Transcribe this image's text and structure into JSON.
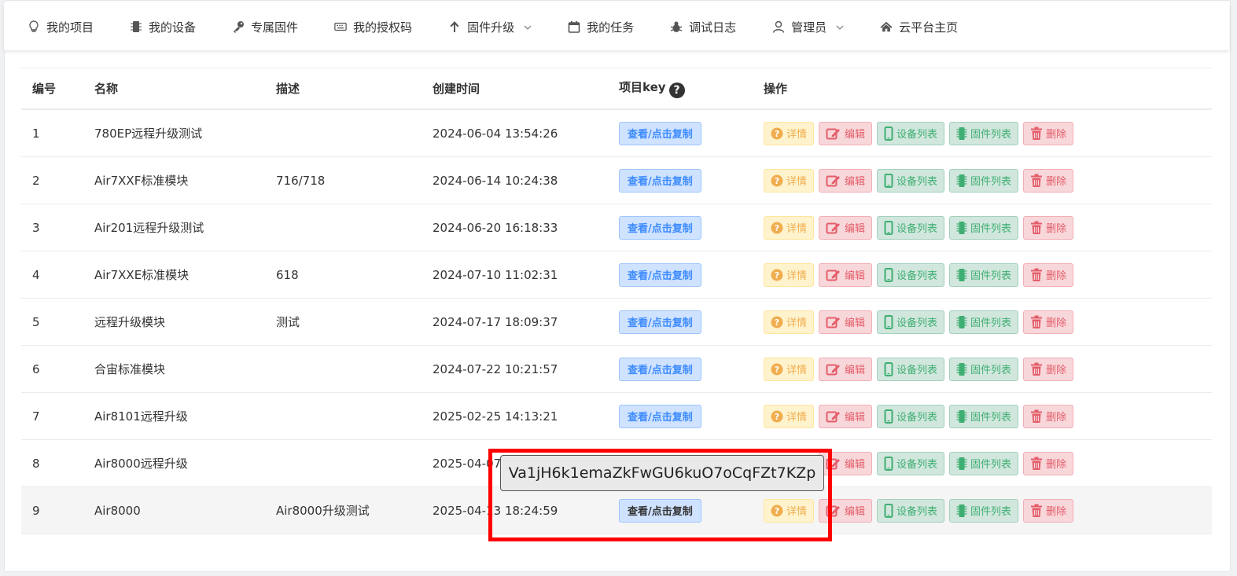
{
  "nav": [
    {
      "label": "我的项目",
      "icon": "lightbulb-icon"
    },
    {
      "label": "我的设备",
      "icon": "chip-icon"
    },
    {
      "label": "专属固件",
      "icon": "key-icon"
    },
    {
      "label": "我的授权码",
      "icon": "keyboard-icon"
    },
    {
      "label": "固件升级",
      "icon": "arrow-up-icon",
      "dropdown": true
    },
    {
      "label": "我的任务",
      "icon": "calendar-icon"
    },
    {
      "label": "调试日志",
      "icon": "bug-icon"
    },
    {
      "label": "管理员",
      "icon": "user-icon",
      "dropdown": true
    },
    {
      "label": "云平台主页",
      "icon": "home-icon"
    }
  ],
  "table": {
    "headers": {
      "id": "编号",
      "name": "名称",
      "desc": "描述",
      "created": "创建时间",
      "key": "项目key",
      "actions": "操作"
    },
    "rows": [
      {
        "id": "1",
        "name": "780EP远程升级测试",
        "desc": "",
        "created": "2024-06-04 13:54:26"
      },
      {
        "id": "2",
        "name": "Air7XXF标准模块",
        "desc": "716/718",
        "created": "2024-06-14 10:24:38"
      },
      {
        "id": "3",
        "name": "Air201远程升级测试",
        "desc": "",
        "created": "2024-06-20 16:18:33"
      },
      {
        "id": "4",
        "name": "Air7XXE标准模块",
        "desc": "618",
        "created": "2024-07-10 11:02:31"
      },
      {
        "id": "5",
        "name": "远程升级模块",
        "desc": "测试",
        "created": "2024-07-17 18:09:37"
      },
      {
        "id": "6",
        "name": "合宙标准模块",
        "desc": "",
        "created": "2024-07-22 10:21:57"
      },
      {
        "id": "7",
        "name": "Air8101远程升级",
        "desc": "",
        "created": "2025-02-25 14:13:21"
      },
      {
        "id": "8",
        "name": "Air8000远程升级",
        "desc": "",
        "created": "2025-04-07"
      },
      {
        "id": "9",
        "name": "Air8000",
        "desc": "Air8000升级测试",
        "created": "2025-04-13 18:24:59"
      }
    ]
  },
  "buttons": {
    "key": "查看/点击复制",
    "detail": "详情",
    "edit": "编辑",
    "devices": "设备列表",
    "firmware": "固件列表",
    "delete": "删除"
  },
  "tooltip": {
    "text": "Va1jH6k1emaZkFwGU6kuO7oCqFZt7KZp"
  },
  "colors": {
    "highlight": "#ff0000",
    "key_btn": "#cfe2ff"
  }
}
